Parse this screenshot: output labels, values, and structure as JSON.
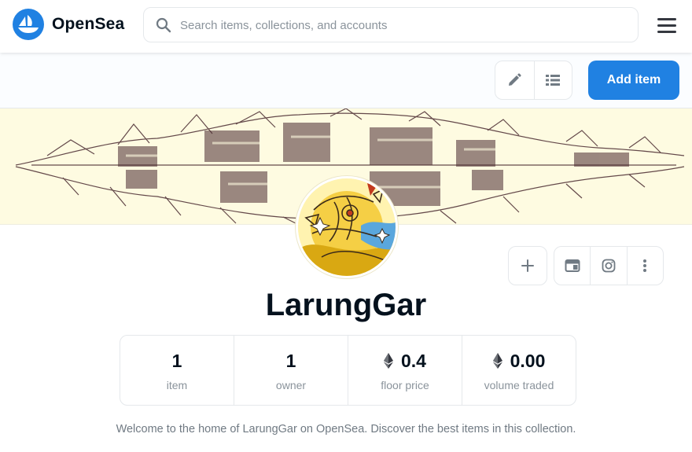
{
  "header": {
    "brand": "OpenSea",
    "search_placeholder": "Search items, collections, and accounts",
    "search_value": ""
  },
  "toolbar": {
    "add_item_label": "Add item",
    "edit_icon": "pencil-icon",
    "list_icon": "list-icon"
  },
  "collection": {
    "name": "LarungGar",
    "description": "Welcome to the home of LarungGar on OpenSea. Discover the best items in this collection."
  },
  "stats": [
    {
      "value": "1",
      "label": "item",
      "eth": false
    },
    {
      "value": "1",
      "label": "owner",
      "eth": false
    },
    {
      "value": "0.4",
      "label": "floor price",
      "eth": true
    },
    {
      "value": "0.00",
      "label": "volume traded",
      "eth": true
    }
  ],
  "actions": {
    "add_icon": "plus-icon",
    "website_icon": "browser-window-icon",
    "instagram_icon": "instagram-icon",
    "more_icon": "more-vertical-icon"
  },
  "colors": {
    "accent": "#2081e2",
    "text_primary": "#04111d",
    "text_secondary": "#8a939b",
    "banner_bg": "#fefbe1"
  }
}
